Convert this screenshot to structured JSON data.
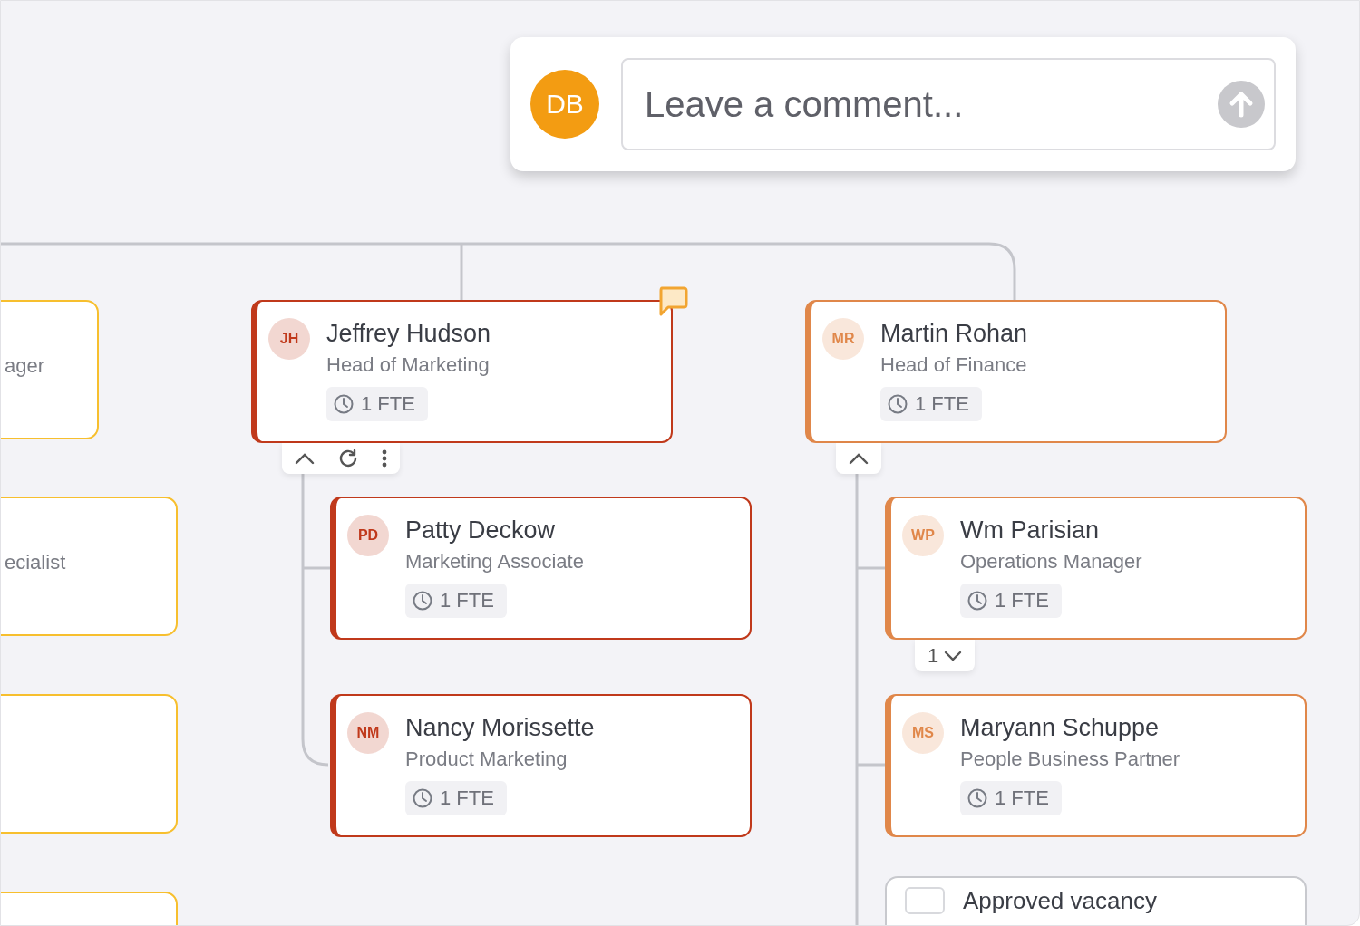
{
  "comment_box": {
    "avatar": "DB",
    "placeholder": "Leave a comment..."
  },
  "left_cards": [
    {
      "kind": "text",
      "title": "ager"
    },
    {
      "kind": "text",
      "title": "ecialist"
    },
    {
      "kind": "blank"
    },
    {
      "kind": "blank"
    }
  ],
  "cards": [
    {
      "initials": "JH",
      "name": "Jeffrey Hudson",
      "role": "Head of Marketing",
      "fte": "1 FTE",
      "color": "#c0391b",
      "has_comment": true,
      "footer": {
        "kind": "actions"
      }
    },
    {
      "initials": "MR",
      "name": "Martin Rohan",
      "role": "Head of Finance",
      "fte": "1 FTE",
      "color": "#e0874a",
      "has_comment": false,
      "footer": {
        "kind": "collapse"
      }
    },
    {
      "initials": "PD",
      "name": "Patty Deckow",
      "role": "Marketing Associate",
      "fte": "1 FTE",
      "color": "#c0391b",
      "has_comment": false
    },
    {
      "initials": "NM",
      "name": "Nancy Morissette",
      "role": "Product Marketing",
      "fte": "1 FTE",
      "color": "#c0391b",
      "has_comment": false
    },
    {
      "initials": "WP",
      "name": "Wm Parisian",
      "role": "Operations Manager",
      "fte": "1 FTE",
      "color": "#e0874a",
      "has_comment": false,
      "footer": {
        "kind": "expand",
        "count": "1"
      }
    },
    {
      "initials": "MS",
      "name": "Maryann Schuppe",
      "role": "People Business Partner",
      "fte": "1 FTE",
      "color": "#e0874a",
      "has_comment": false
    }
  ],
  "vacancy": {
    "title": "Approved vacancy"
  }
}
